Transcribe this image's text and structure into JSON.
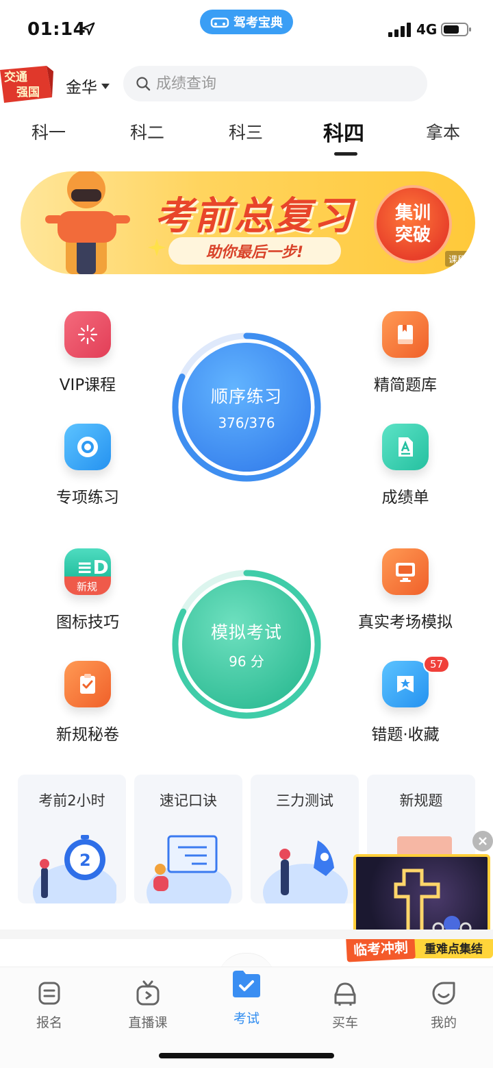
{
  "status_bar": {
    "time": "01:14",
    "network": "4G",
    "app_pill": "驾考宝典"
  },
  "header": {
    "badge_text": "交通强国",
    "city": "金华",
    "search_placeholder": "成绩查询"
  },
  "tabs": [
    {
      "label": "科一",
      "active": false
    },
    {
      "label": "科二",
      "active": false
    },
    {
      "label": "科三",
      "active": false
    },
    {
      "label": "科四",
      "active": true
    },
    {
      "label": "拿本",
      "active": false
    }
  ],
  "banner": {
    "title": "考前总复习",
    "subtitle": "助你最后一步!",
    "cta_line1": "集训",
    "cta_line2": "突破",
    "tag": "课程"
  },
  "features": {
    "vip_course": {
      "label": "VIP课程",
      "icon": "sparkle-icon",
      "color": "#e8455d"
    },
    "concise_bank": {
      "label": "精简题库",
      "icon": "book-icon",
      "color": "#f0652c"
    },
    "special_practice": {
      "label": "专项练习",
      "icon": "target-icon",
      "color": "#2f9af2"
    },
    "score_sheet": {
      "label": "成绩单",
      "icon": "document-icon",
      "color": "#2cc6a5"
    },
    "sign_tips": {
      "label": "图标技巧",
      "icon": "new-rule-icon",
      "badge": "新规",
      "color": "#2cc6a5"
    },
    "real_exam": {
      "label": "真实考场模拟",
      "icon": "monitor-icon",
      "color": "#f0652c"
    },
    "new_rule_secret": {
      "label": "新规秘卷",
      "icon": "clipboard-check-icon",
      "color": "#f0652c"
    },
    "mistakes": {
      "label": "错题·收藏",
      "icon": "star-bookmark-icon",
      "badge": "57",
      "color": "#2f9af2"
    }
  },
  "sequence_practice": {
    "title": "顺序练习",
    "progress": "376/376",
    "fraction": 1.0
  },
  "mock_exam": {
    "title": "模拟考试",
    "score": "96 分",
    "fraction": 0.96
  },
  "shortcuts": [
    {
      "title": "考前2小时",
      "icon": "stopwatch-icon"
    },
    {
      "title": "速记口诀",
      "icon": "whiteboard-icon"
    },
    {
      "title": "三力测试",
      "icon": "rocket-icon"
    },
    {
      "title": "新规题",
      "icon": "new-rule-book-icon"
    }
  ],
  "promo": {
    "tag1": "临考冲刺",
    "tag2": "重难点集结"
  },
  "bottom_nav": [
    {
      "label": "报名",
      "icon": "form-icon",
      "active": false
    },
    {
      "label": "直播课",
      "icon": "tv-icon",
      "active": false
    },
    {
      "label": "考试",
      "icon": "folder-check-icon",
      "active": true
    },
    {
      "label": "买车",
      "icon": "car-icon",
      "active": false
    },
    {
      "label": "我的",
      "icon": "smile-icon",
      "active": false
    }
  ],
  "colors": {
    "accent": "#2f8cf0",
    "sequence_ring": "#3e8ef0",
    "mock_ring": "#3fcca8"
  }
}
